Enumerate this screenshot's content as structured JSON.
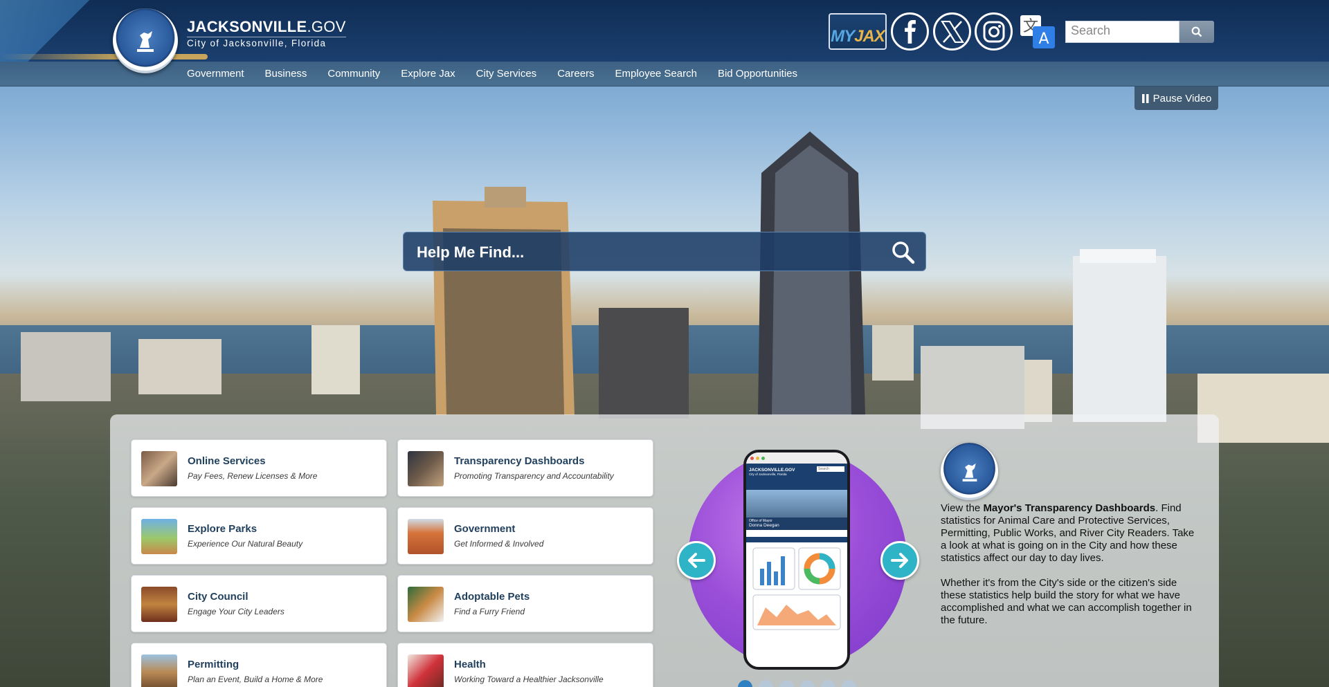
{
  "header": {
    "brand_title": "JACKSONVILLE",
    "brand_gov": ".GOV",
    "brand_sub": "City of Jacksonville, Florida",
    "seal_alt": "City of Jacksonville seal",
    "myjax_a": "MY",
    "myjax_b": "JAX",
    "search_placeholder": "Search"
  },
  "nav": {
    "items": [
      "Government",
      "Business",
      "Community",
      "Explore Jax",
      "City Services",
      "Careers",
      "Employee Search",
      "Bid Opportunities"
    ]
  },
  "video": {
    "pause_label": "Pause Video"
  },
  "hero": {
    "search_placeholder": "Help Me Find..."
  },
  "cards": [
    {
      "title": "Online Services",
      "desc": "Pay Fees, Renew Licenses & More"
    },
    {
      "title": "Transparency Dashboards",
      "desc": "Promoting Transparency and Accountability"
    },
    {
      "title": "Explore Parks",
      "desc": "Experience Our Natural Beauty"
    },
    {
      "title": "Government",
      "desc": "Get Informed & Involved"
    },
    {
      "title": "City Council",
      "desc": "Engage Your City Leaders"
    },
    {
      "title": "Adoptable Pets",
      "desc": "Find a Furry Friend"
    },
    {
      "title": "Permitting",
      "desc": "Plan an Event, Build a Home & More"
    },
    {
      "title": "Health",
      "desc": "Working Toward a Healthier Jacksonville"
    }
  ],
  "promo": {
    "p1_pre": "View the ",
    "p1_bold": "Mayor's Transparency Dashboards",
    "p1_post": ". Find statistics for Animal Care and Protective Services, Permitting, Public Works, and River City Readers. Take a look at what is going on in the City and how these statistics affect our day to day lives.",
    "p2": "Whether it's from the City's side or the citizen's side these statistics help build the story for what we have accomplished and what we can accomplish together in the future.",
    "phone_brand": "JACKSONVILLE.GOV",
    "phone_sub": "City of Jacksonville, Florida",
    "phone_office": "Office of Mayor",
    "phone_name": "Donna Deegan",
    "phone_search": "Search"
  },
  "carousel": {
    "active_index": 0,
    "slide_count": 6
  },
  "colors": {
    "header_bg": "#163766",
    "nav_bg": "#45698b",
    "card_title": "#1f3f5d",
    "carousel_arrow": "#2fb3c6",
    "promo_circle": "#9b4fd9",
    "hmf_bg": "#1e3e68"
  }
}
